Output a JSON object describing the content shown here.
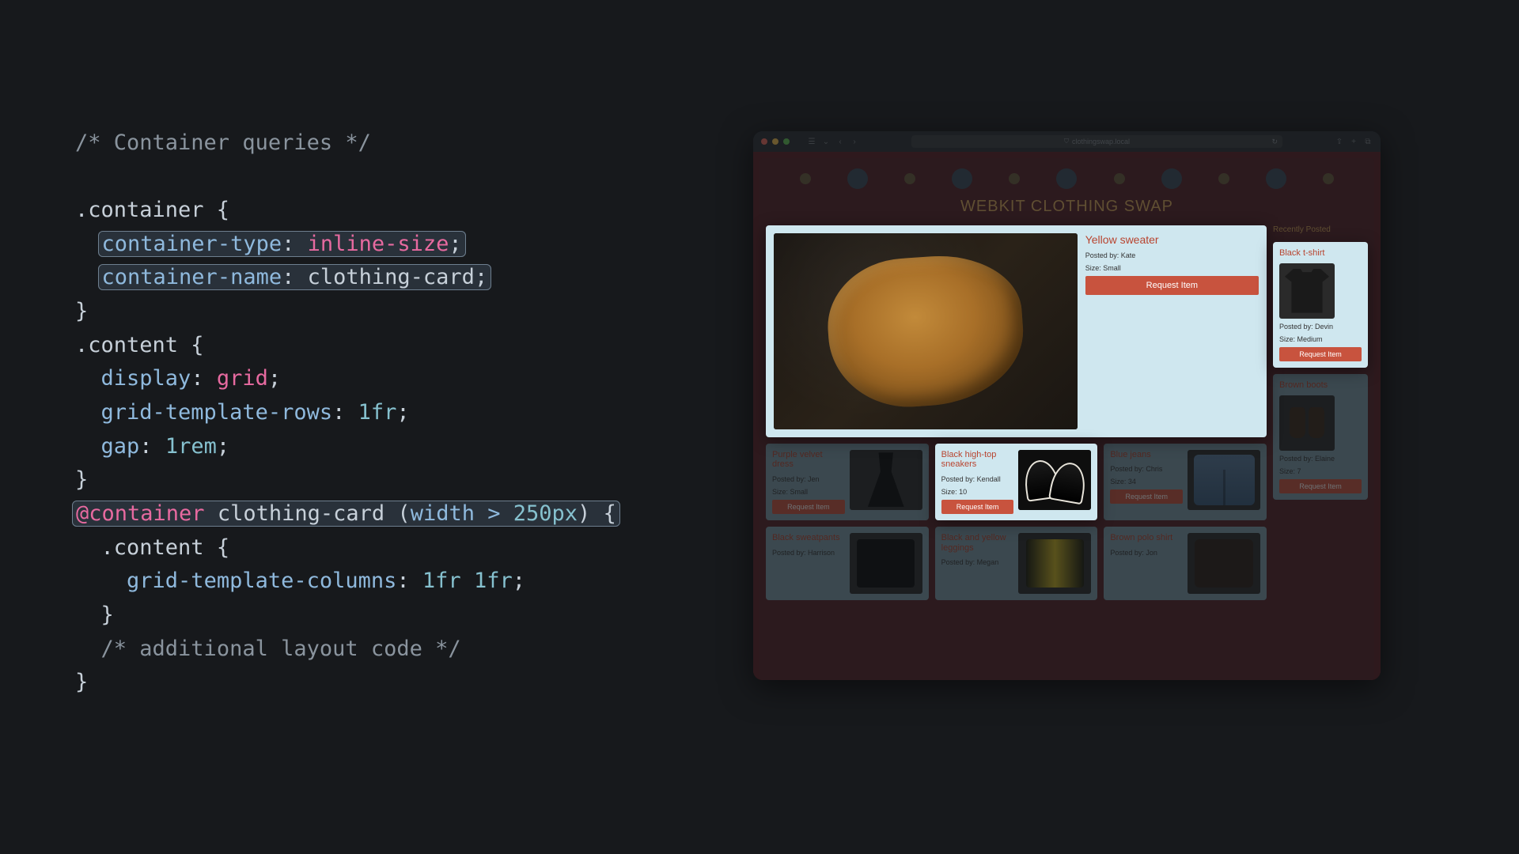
{
  "code": {
    "comment_top": "/* Container queries */",
    "sel_container": ".container {",
    "prop_ctype": "container-type",
    "val_ctype": "inline-size",
    "prop_cname": "container-name",
    "val_cname": "clothing-card",
    "close1": "}",
    "sel_content": ".content {",
    "prop_display": "display",
    "val_display": "grid",
    "prop_gtr": "grid-template-rows",
    "val_gtr": "1fr",
    "prop_gap": "gap",
    "val_gap": "1rem",
    "close2": "}",
    "at_container": "@container",
    "at_name": "clothing-card",
    "at_paren_open": "(",
    "at_prop": "width",
    "at_gt": ">",
    "at_val": "250px",
    "at_paren_close": ")",
    "at_brace": " {",
    "inner_sel": ".content {",
    "prop_gtc": "grid-template-columns",
    "val_gtc": "1fr 1fr",
    "inner_close": "}",
    "comment_add": "/* additional layout code */",
    "outer_close": "}"
  },
  "browser": {
    "url": "clothingswap.local",
    "site_title": "WEBKIT CLOTHING SWAP",
    "sidebar_title": "Recently Posted",
    "btn_label": "Request Item"
  },
  "items": {
    "feature": {
      "title": "Yellow sweater",
      "posted": "Posted by: Kate",
      "size": "Size: Small"
    },
    "row1": [
      {
        "title": "Purple velvet dress",
        "posted": "Posted by: Jen",
        "size": "Size: Small"
      },
      {
        "title": "Black high-top sneakers",
        "posted": "Posted by: Kendall",
        "size": "Size: 10"
      },
      {
        "title": "Blue jeans",
        "posted": "Posted by: Chris",
        "size": "Size: 34"
      }
    ],
    "row2": [
      {
        "title": "Black sweatpants",
        "posted": "Posted by: Harrison",
        "size": ""
      },
      {
        "title": "Black and yellow leggings",
        "posted": "Posted by: Megan",
        "size": ""
      },
      {
        "title": "Brown polo shirt",
        "posted": "Posted by: Jon",
        "size": ""
      }
    ],
    "side": [
      {
        "title": "Black t-shirt",
        "posted": "Posted by: Devin",
        "size": "Size: Medium"
      },
      {
        "title": "Brown boots",
        "posted": "Posted by: Elaine",
        "size": "Size: 7"
      }
    ]
  }
}
